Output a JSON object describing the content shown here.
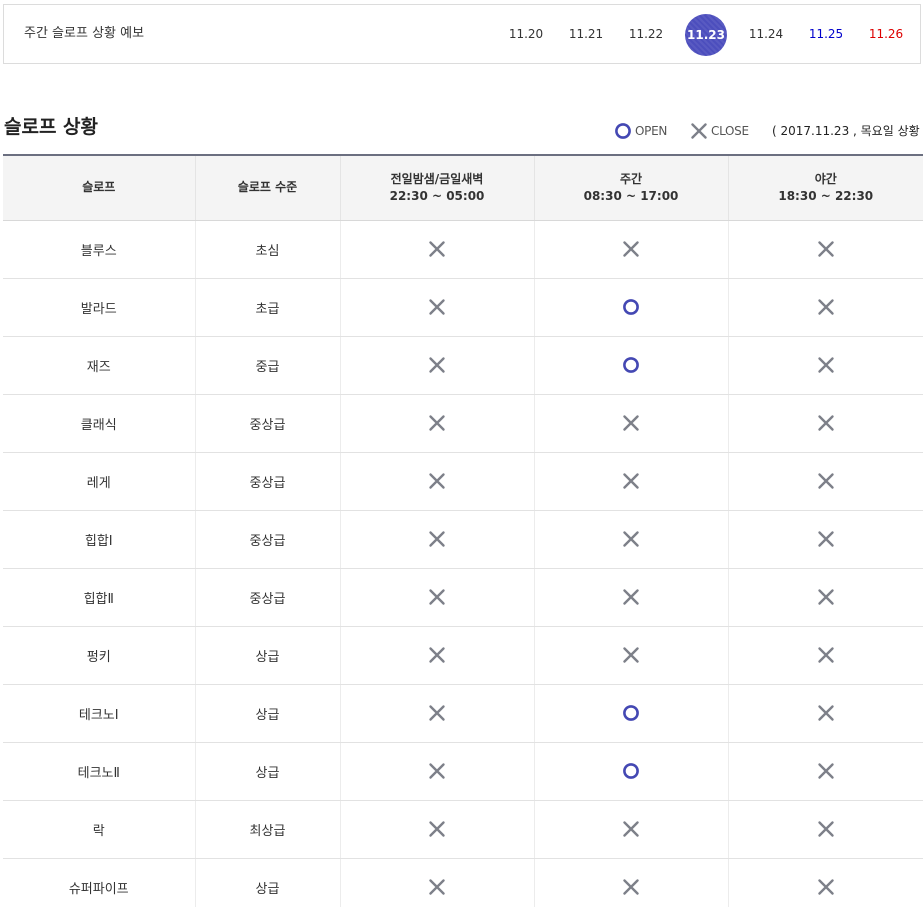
{
  "forecast": {
    "title": "주간 슬로프 상황 예보",
    "dates": [
      {
        "label": "11.20",
        "state": "normal"
      },
      {
        "label": "11.21",
        "state": "normal"
      },
      {
        "label": "11.22",
        "state": "normal"
      },
      {
        "label": "11.23",
        "state": "active"
      },
      {
        "label": "11.24",
        "state": "normal"
      },
      {
        "label": "11.25",
        "state": "sat"
      },
      {
        "label": "11.26",
        "state": "sun"
      }
    ]
  },
  "section": {
    "title": "슬로프 상황",
    "legend_open": "OPEN",
    "legend_close": "CLOSE",
    "status_date": "( 2017.11.23 , 목요일 상황 )"
  },
  "table": {
    "headers": [
      {
        "title": "슬로프",
        "sub": ""
      },
      {
        "title": "슬로프 수준",
        "sub": ""
      },
      {
        "title": "전일밤샘/금일새벽",
        "sub": "22:30 ~ 05:00"
      },
      {
        "title": "주간",
        "sub": "08:30 ~ 17:00"
      },
      {
        "title": "야간",
        "sub": "18:30 ~ 22:30"
      }
    ],
    "rows": [
      {
        "name": "블루스",
        "level": "초심",
        "status": [
          "close",
          "close",
          "close"
        ]
      },
      {
        "name": "발라드",
        "level": "초급",
        "status": [
          "close",
          "open",
          "close"
        ]
      },
      {
        "name": "재즈",
        "level": "중급",
        "status": [
          "close",
          "open",
          "close"
        ]
      },
      {
        "name": "클래식",
        "level": "중상급",
        "status": [
          "close",
          "close",
          "close"
        ]
      },
      {
        "name": "레게",
        "level": "중상급",
        "status": [
          "close",
          "close",
          "close"
        ]
      },
      {
        "name": "힙합Ⅰ",
        "level": "중상급",
        "status": [
          "close",
          "close",
          "close"
        ]
      },
      {
        "name": "힙합Ⅱ",
        "level": "중상급",
        "status": [
          "close",
          "close",
          "close"
        ]
      },
      {
        "name": "펑키",
        "level": "상급",
        "status": [
          "close",
          "close",
          "close"
        ]
      },
      {
        "name": "테크노Ⅰ",
        "level": "상급",
        "status": [
          "close",
          "open",
          "close"
        ]
      },
      {
        "name": "테크노Ⅱ",
        "level": "상급",
        "status": [
          "close",
          "open",
          "close"
        ]
      },
      {
        "name": "락",
        "level": "최상급",
        "status": [
          "close",
          "close",
          "close"
        ]
      },
      {
        "name": "슈퍼파이프",
        "level": "상급",
        "status": [
          "close",
          "close",
          "close"
        ]
      }
    ]
  },
  "colors": {
    "accent": "#4c4ebd",
    "open_icon": "#4448b3",
    "close_icon": "#7d8089",
    "saturday": "#0000cc",
    "sunday": "#dd0000"
  },
  "icons": {
    "open": "open-circle-icon",
    "close": "close-x-icon"
  }
}
